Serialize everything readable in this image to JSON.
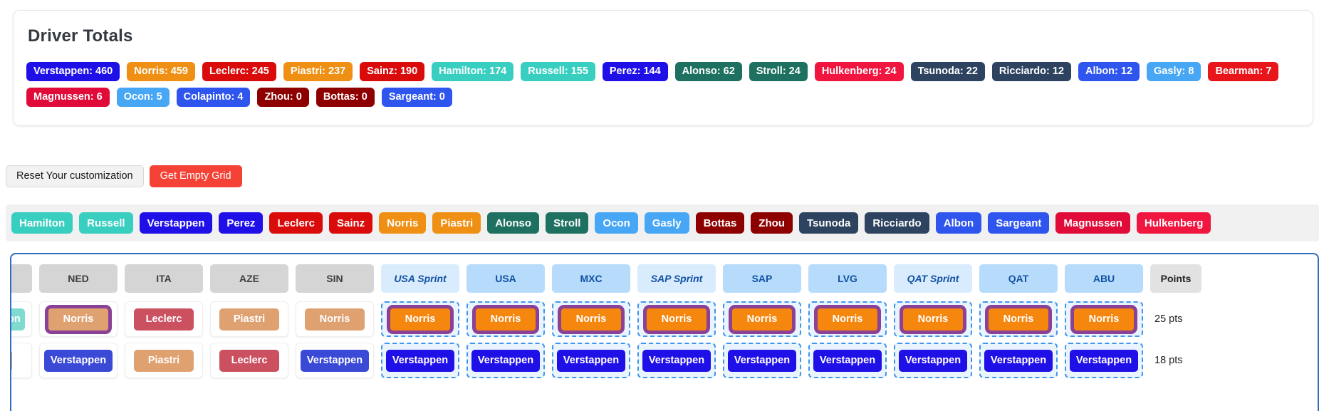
{
  "totals": {
    "title": "Driver Totals",
    "rows": [
      [
        {
          "label": "Verstappen: 460",
          "color": "#2010e8"
        },
        {
          "label": "Norris: 459",
          "color": "#ef9015"
        },
        {
          "label": "Leclerc: 245",
          "color": "#d90b0b"
        },
        {
          "label": "Piastri: 237",
          "color": "#ef9015"
        },
        {
          "label": "Sainz: 190",
          "color": "#d90b0b"
        },
        {
          "label": "Hamilton: 174",
          "color": "#39cfc0"
        },
        {
          "label": "Russell: 155",
          "color": "#39cfc0"
        },
        {
          "label": "Perez: 144",
          "color": "#2010e8"
        },
        {
          "label": "Alonso: 62",
          "color": "#1e7161"
        },
        {
          "label": "Stroll: 24",
          "color": "#1e7161"
        },
        {
          "label": "Hulkenberg: 24",
          "color": "#f01640"
        },
        {
          "label": "Tsunoda: 22",
          "color": "#2e4360"
        },
        {
          "label": "Ricciardo: 12",
          "color": "#2e4360"
        },
        {
          "label": "Albon: 12",
          "color": "#2f55ef"
        },
        {
          "label": "Gasly: 8",
          "color": "#47a7f5"
        },
        {
          "label": "Bearman: 7",
          "color": "#e8151b"
        }
      ],
      [
        {
          "label": "Magnussen: 6",
          "color": "#e00b38"
        },
        {
          "label": "Ocon: 5",
          "color": "#47a7f5"
        },
        {
          "label": "Colapinto: 4",
          "color": "#2f55ef"
        },
        {
          "label": "Zhou: 0",
          "color": "#8e0000"
        },
        {
          "label": "Bottas: 0",
          "color": "#8e0000"
        },
        {
          "label": "Sargeant: 0",
          "color": "#2f55ef"
        }
      ]
    ]
  },
  "buttons": {
    "reset_label": "Reset Your customization",
    "empty_grid_label": "Get Empty Grid"
  },
  "chips": [
    {
      "label": "Hamilton",
      "color": "#39cfc0"
    },
    {
      "label": "Russell",
      "color": "#39cfc0"
    },
    {
      "label": "Verstappen",
      "color": "#2010e8"
    },
    {
      "label": "Perez",
      "color": "#2010e8"
    },
    {
      "label": "Leclerc",
      "color": "#d90b0b"
    },
    {
      "label": "Sainz",
      "color": "#d90b0b"
    },
    {
      "label": "Norris",
      "color": "#ef9015"
    },
    {
      "label": "Piastri",
      "color": "#ef9015"
    },
    {
      "label": "Alonso",
      "color": "#1e7161"
    },
    {
      "label": "Stroll",
      "color": "#1e7161"
    },
    {
      "label": "Ocon",
      "color": "#47a7f5"
    },
    {
      "label": "Gasly",
      "color": "#47a7f5"
    },
    {
      "label": "Bottas",
      "color": "#8e0000"
    },
    {
      "label": "Zhou",
      "color": "#8e0000"
    },
    {
      "label": "Tsunoda",
      "color": "#2e4360"
    },
    {
      "label": "Ricciardo",
      "color": "#2e4360"
    },
    {
      "label": "Albon",
      "color": "#2f55ef"
    },
    {
      "label": "Sargeant",
      "color": "#2f55ef"
    },
    {
      "label": "Magnussen",
      "color": "#e00b38"
    },
    {
      "label": "Hulkenberg",
      "color": "#f01640"
    }
  ],
  "grid": {
    "headers": [
      {
        "label": "",
        "kind": "partial"
      },
      {
        "label": "NED",
        "kind": "past"
      },
      {
        "label": "ITA",
        "kind": "past"
      },
      {
        "label": "AZE",
        "kind": "past"
      },
      {
        "label": "SIN",
        "kind": "past"
      },
      {
        "label": "USA Sprint",
        "kind": "sprint"
      },
      {
        "label": "USA",
        "kind": "future"
      },
      {
        "label": "MXC",
        "kind": "future"
      },
      {
        "label": "SAP Sprint",
        "kind": "sprint"
      },
      {
        "label": "SAP",
        "kind": "future"
      },
      {
        "label": "LVG",
        "kind": "future"
      },
      {
        "label": "QAT Sprint",
        "kind": "sprint"
      },
      {
        "label": "QAT",
        "kind": "future"
      },
      {
        "label": "ABU",
        "kind": "future"
      },
      {
        "label": "Points",
        "kind": "points"
      }
    ],
    "rows": [
      {
        "points": "25 pts",
        "partial": {
          "label": "on",
          "color": "#7fdbcf"
        },
        "cells": [
          {
            "label": "Norris",
            "color": "#e0a171",
            "dashed": false,
            "highlight": true
          },
          {
            "label": "Leclerc",
            "color": "#cb5060",
            "dashed": false,
            "highlight": false
          },
          {
            "label": "Piastri",
            "color": "#e0a171",
            "dashed": false,
            "highlight": false
          },
          {
            "label": "Norris",
            "color": "#e0a171",
            "dashed": false,
            "highlight": false
          },
          {
            "label": "Norris",
            "color": "#f5860e",
            "dashed": true,
            "highlight": true
          },
          {
            "label": "Norris",
            "color": "#f5860e",
            "dashed": true,
            "highlight": true
          },
          {
            "label": "Norris",
            "color": "#f5860e",
            "dashed": true,
            "highlight": true
          },
          {
            "label": "Norris",
            "color": "#f5860e",
            "dashed": true,
            "highlight": true
          },
          {
            "label": "Norris",
            "color": "#f5860e",
            "dashed": true,
            "highlight": true
          },
          {
            "label": "Norris",
            "color": "#f5860e",
            "dashed": true,
            "highlight": true
          },
          {
            "label": "Norris",
            "color": "#f5860e",
            "dashed": true,
            "highlight": true
          },
          {
            "label": "Norris",
            "color": "#f5860e",
            "dashed": true,
            "highlight": true
          },
          {
            "label": "Norris",
            "color": "#f5860e",
            "dashed": true,
            "highlight": true
          }
        ]
      },
      {
        "points": "18 pts",
        "partial": {
          "label": "",
          "color": "#e0a171"
        },
        "cells": [
          {
            "label": "Verstappen",
            "color": "#3a49d6",
            "dashed": false,
            "highlight": false
          },
          {
            "label": "Piastri",
            "color": "#e0a171",
            "dashed": false,
            "highlight": false
          },
          {
            "label": "Leclerc",
            "color": "#cb5060",
            "dashed": false,
            "highlight": false
          },
          {
            "label": "Verstappen",
            "color": "#3a49d6",
            "dashed": false,
            "highlight": false
          },
          {
            "label": "Verstappen",
            "color": "#2010e8",
            "dashed": true,
            "highlight": false
          },
          {
            "label": "Verstappen",
            "color": "#2010e8",
            "dashed": true,
            "highlight": false
          },
          {
            "label": "Verstappen",
            "color": "#2010e8",
            "dashed": true,
            "highlight": false
          },
          {
            "label": "Verstappen",
            "color": "#2010e8",
            "dashed": true,
            "highlight": false
          },
          {
            "label": "Verstappen",
            "color": "#2010e8",
            "dashed": true,
            "highlight": false
          },
          {
            "label": "Verstappen",
            "color": "#2010e8",
            "dashed": true,
            "highlight": false
          },
          {
            "label": "Verstappen",
            "color": "#2010e8",
            "dashed": true,
            "highlight": false
          },
          {
            "label": "Verstappen",
            "color": "#2010e8",
            "dashed": true,
            "highlight": false
          },
          {
            "label": "Verstappen",
            "color": "#2010e8",
            "dashed": true,
            "highlight": false
          }
        ]
      }
    ]
  }
}
